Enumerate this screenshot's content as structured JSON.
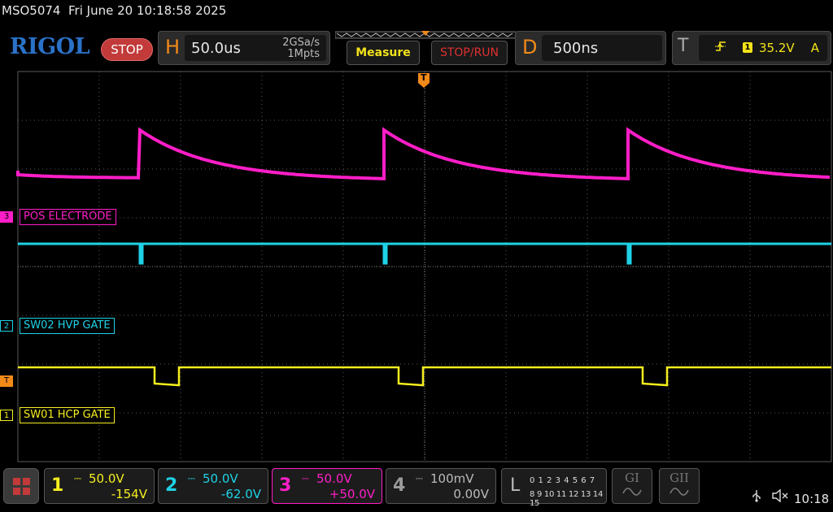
{
  "status": {
    "model": "MSO5074",
    "datetime": "Fri June 20 10:18:58 2025"
  },
  "header": {
    "logo": "RIGOL",
    "run_state": "STOP",
    "horizontal": {
      "letter": "H",
      "timebase": "50.0us",
      "sample_rate": "2GSa/s",
      "memory_depth": "1Mpts"
    },
    "measure_label": "Measure",
    "stop_run_label": "STOP/RUN",
    "delay": {
      "letter": "D",
      "value": "500ns"
    },
    "trigger": {
      "letter": "T",
      "edge_icon": "rising-edge-icon",
      "source": "1",
      "level": "35.2V",
      "mode": "A"
    }
  },
  "channels_on_screen": [
    {
      "id": "3",
      "label": "POS ELECTRODE",
      "color": "#ff1ec8"
    },
    {
      "id": "2",
      "label": "SW02 HVP GATE",
      "color": "#1ed2e6"
    },
    {
      "id": "1",
      "label": "SW01 HCP GATE",
      "color": "#f5ee1e"
    }
  ],
  "trigger_marker": "T",
  "colors": {
    "ch1": "#f5ee1e",
    "ch2": "#1ed2e6",
    "ch3": "#ff1ec8",
    "ch4": "#9a9a9a",
    "accent_orange": "#f28a1a",
    "grid": "#5a5a5a"
  },
  "footer": {
    "ch1": {
      "num": "1",
      "scale": "50.0V",
      "offset": "-154V"
    },
    "ch2": {
      "num": "2",
      "scale": "50.0V",
      "offset": "-62.0V"
    },
    "ch3": {
      "num": "3",
      "scale": "50.0V",
      "offset": "+50.0V"
    },
    "ch4": {
      "num": "4",
      "scale": "100mV",
      "offset": "0.00V"
    },
    "logic": {
      "letter": "L",
      "row1": "0 1 2 3  4 5 6 7",
      "row2": "8 9 10 11 12 13 14 15"
    },
    "gen1": "GI",
    "gen2": "GII",
    "time": "10:18"
  }
}
